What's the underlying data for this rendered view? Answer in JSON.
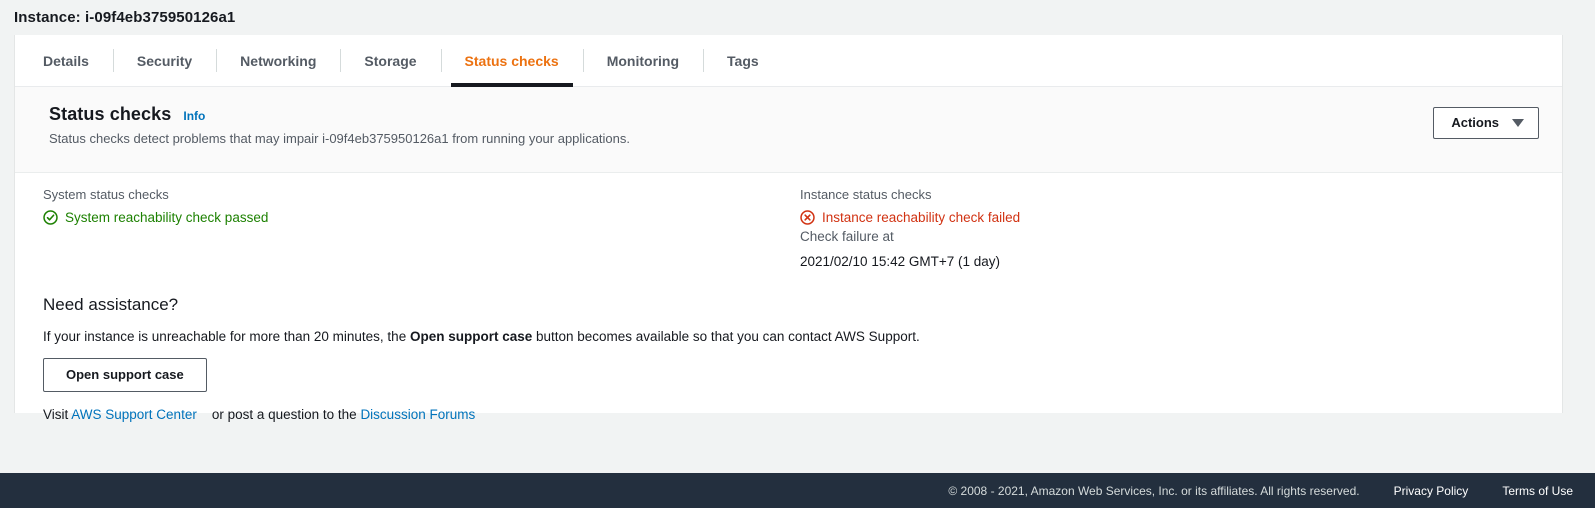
{
  "page": {
    "instance_title": "Instance: i-09f4eb375950126a1"
  },
  "tabs": [
    {
      "label": "Details",
      "active": false
    },
    {
      "label": "Security",
      "active": false
    },
    {
      "label": "Networking",
      "active": false
    },
    {
      "label": "Storage",
      "active": false
    },
    {
      "label": "Status checks",
      "active": true
    },
    {
      "label": "Monitoring",
      "active": false
    },
    {
      "label": "Tags",
      "active": false
    }
  ],
  "card": {
    "title": "Status checks",
    "info_label": "Info",
    "description": "Status checks detect problems that may impair i-09f4eb375950126a1 from running your applications.",
    "actions_label": "Actions",
    "actions_caret": "chevron-down-icon"
  },
  "status": {
    "system": {
      "column_label": "System status checks",
      "icon": "check-circle-icon",
      "result": "System reachability check passed",
      "color": "#1d8102"
    },
    "instance": {
      "column_label": "Instance status checks",
      "icon": "error-circle-icon",
      "result": "Instance reachability check failed",
      "color": "#d13212",
      "failure_label": "Check failure at",
      "failure_time": "2021/02/10 15:42 GMT+7 (1 day)"
    }
  },
  "assistance": {
    "title": "Need assistance?",
    "para_before": "If your instance is unreachable for more than 20 minutes, the ",
    "para_bold": "Open support case",
    "para_after": " button becomes available so that you can contact AWS Support.",
    "support_button": "Open support case",
    "visit_prefix": "Visit ",
    "support_center_link": "AWS Support Center",
    "visit_middle": "or post a question to the ",
    "forums_link": "Discussion Forums"
  },
  "footer": {
    "copyright": "© 2008 - 2021, Amazon Web Services, Inc. or its affiliates. All rights reserved.",
    "privacy_label": "Privacy Policy",
    "terms_label": "Terms of Use"
  },
  "colors": {
    "accent_orange": "#ec7211",
    "link_blue": "#0073bb",
    "success_green": "#1d8102",
    "error_red": "#d13212",
    "footer_navy": "#232f3e"
  }
}
